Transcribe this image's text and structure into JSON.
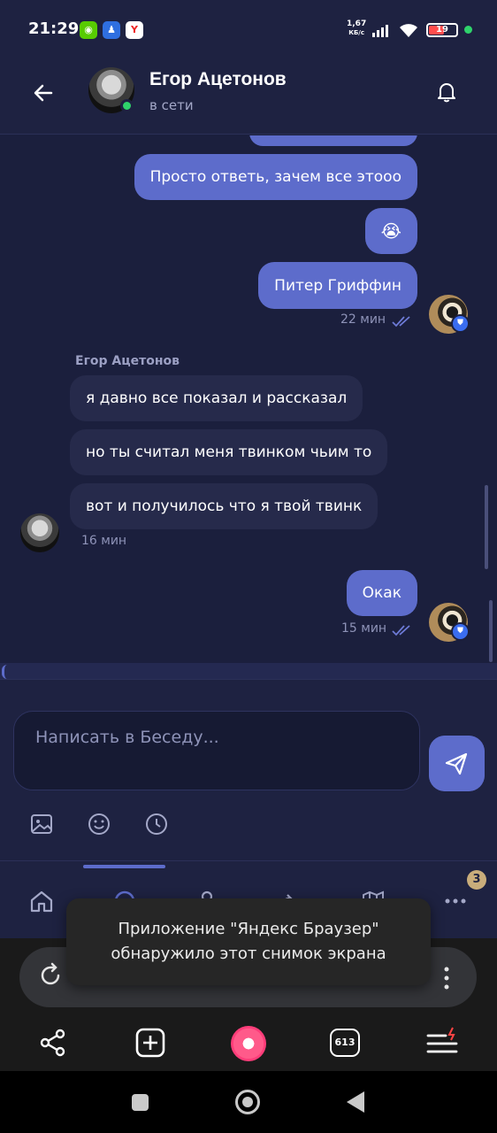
{
  "status_bar": {
    "time": "21:29",
    "speed_value": "1,67",
    "speed_unit": "КБ/с",
    "battery": "19",
    "apps": [
      {
        "icon": "duolingo-icon",
        "color": "#58cc02",
        "glyph": "◉◉"
      },
      {
        "icon": "lock-app-icon",
        "color": "#2f6fe0",
        "glyph": "♟"
      },
      {
        "icon": "yandex-icon",
        "color": "#ffffff",
        "glyph": "Y"
      }
    ]
  },
  "header": {
    "contact_name": "Егор Ацетонов",
    "contact_status": "в сети",
    "back_icon": "arrow-left-icon",
    "bell_icon": "bell-icon"
  },
  "messages": [
    {
      "side": "out",
      "text": ""
    },
    {
      "side": "out",
      "text": "Просто ответь, зачем все этооо"
    },
    {
      "side": "out",
      "text": "😭"
    },
    {
      "side": "out",
      "text": "Питер Гриффин"
    },
    {
      "side": "in",
      "text": "я давно все показал и рассказал"
    },
    {
      "side": "in",
      "text": "но ты считал меня твинком чьим то"
    },
    {
      "side": "in",
      "text": "вот и получилось что я твой твинк"
    },
    {
      "side": "out",
      "text": "Окак"
    }
  ],
  "meta": {
    "out_time_1": "22 мин",
    "sender_name": "Егор Ацетонов",
    "in_time": "16 мин",
    "out_time_2": "15 мин"
  },
  "composer": {
    "placeholder": "Написать в Беседу...",
    "tools": [
      "image-icon",
      "emoji-icon",
      "clock-icon"
    ],
    "send_icon": "send-icon"
  },
  "tabbar": {
    "tabs": [
      "home-icon",
      "search-icon",
      "friends-icon",
      "music-icon",
      "map-icon",
      "more-icon"
    ],
    "badge": "3"
  },
  "browser": {
    "tabs_count": "613",
    "icons": [
      "share-icon",
      "new-tab-icon",
      "alice-icon",
      "tabs-icon",
      "menu-icon"
    ]
  },
  "toast": {
    "line1": "Приложение \"Яндекс Браузер\"",
    "line2": "обнаружило этот снимок экрана"
  },
  "colors": {
    "background": "#1b1f3d",
    "header": "#1e2241",
    "outgoing_bubble": "#5d6ccb",
    "incoming_bubble": "#262a4b",
    "online": "#2fd36b"
  }
}
